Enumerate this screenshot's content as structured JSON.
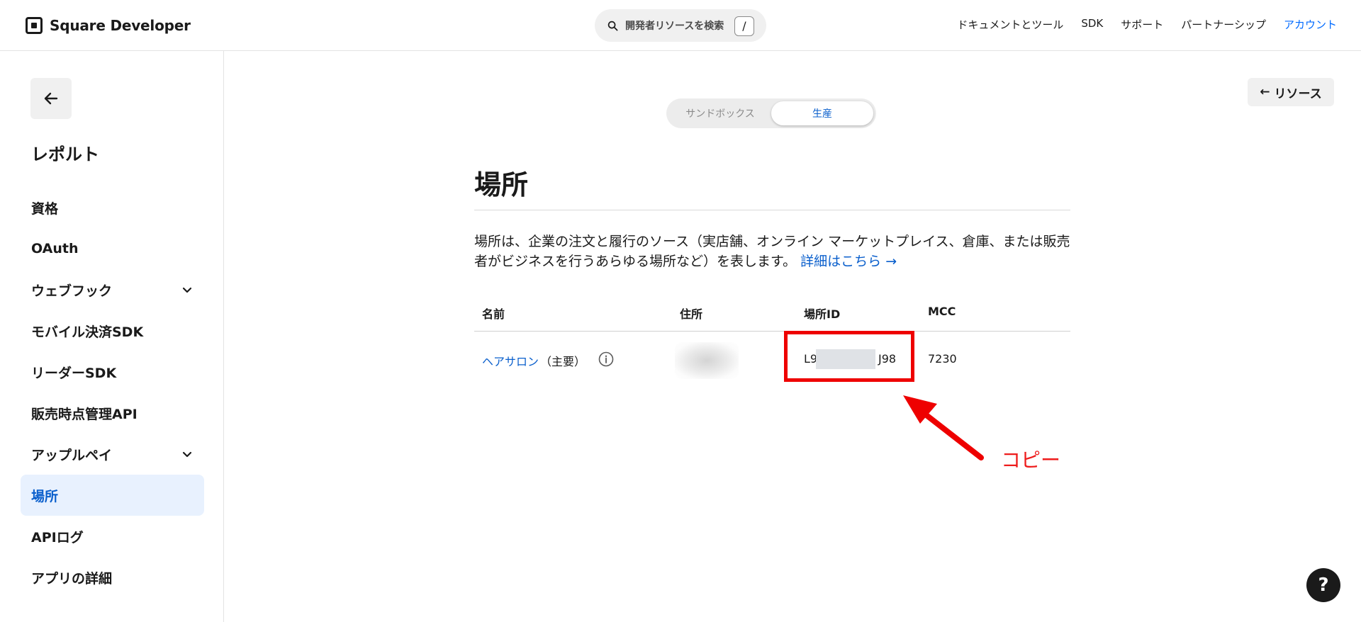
{
  "header": {
    "brand": "Square Developer",
    "search_placeholder": "開発者リソースを検索",
    "search_shortcut": "/",
    "nav": {
      "docs": "ドキュメントとツール",
      "sdk": "SDK",
      "support": "サポート",
      "partnership": "パートナーシップ",
      "account": "アカウント"
    }
  },
  "sidebar": {
    "app_name": "レポルト",
    "items": [
      {
        "label": "資格"
      },
      {
        "label": "OAuth"
      },
      {
        "label": "ウェブフック",
        "expandable": true
      },
      {
        "label": "モバイル決済SDK"
      },
      {
        "label": "リーダーSDK"
      },
      {
        "label": "販売時点管理API"
      },
      {
        "label": "アップルペイ",
        "expandable": true
      },
      {
        "label": "場所",
        "active": true
      },
      {
        "label": "APIログ"
      },
      {
        "label": "アプリの詳細"
      }
    ]
  },
  "main": {
    "resources_button": "リソース",
    "environment": {
      "sandbox": "サンドボックス",
      "production": "生産",
      "selected": "生産"
    },
    "title": "場所",
    "description": "場所は、企業の注文と履行のソース（実店舗、オンライン マーケットプレイス、倉庫、または販売者がビジネスを行うあらゆる場所など）を表します。",
    "learn_more": "詳細はこちら →",
    "table": {
      "headers": {
        "name": "名前",
        "address": "住所",
        "location_id": "場所ID",
        "mcc": "MCC"
      },
      "row": {
        "name": "ヘアサロン",
        "primary": "（主要）",
        "id_prefix": "L9",
        "id_suffix": "J98",
        "mcc": "7230"
      }
    },
    "annotation": "コピー"
  },
  "colors": {
    "accent": "#006aff",
    "link": "#0a5fcc",
    "annotation": "#ee0000",
    "active_bg": "#e8f1fe"
  },
  "help_label": "?"
}
